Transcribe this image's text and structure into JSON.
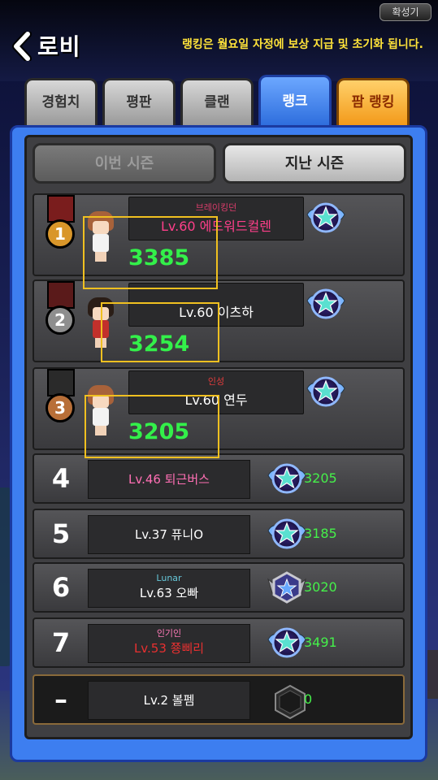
{
  "topbar": {
    "zoom_label": "확성기",
    "back_label": "로비",
    "notice": "랭킹은 월요일 자정에 보상 지급 및 초기화 됩니다."
  },
  "tabs": [
    {
      "label": "경험치"
    },
    {
      "label": "평판"
    },
    {
      "label": "클랜"
    },
    {
      "label": "랭크"
    },
    {
      "label": "팜 랭킹"
    }
  ],
  "active_tab": "랭크",
  "season": {
    "this_label": "이번 시즌",
    "last_label": "지난 시즌",
    "selected": "지난 시즌"
  },
  "top_ranks": [
    {
      "rank": "1",
      "medal_color": "#d9962a",
      "ribbon_color": "#7a1d1d",
      "guild": "브레이킹던",
      "guild_color": "#d73c6a",
      "name": "Lv.60 에드워드컬렌",
      "name_color": "#ff3f8a",
      "score": "3385",
      "hair": "#a8623a",
      "outfit": "#f3f3f3"
    },
    {
      "rank": "2",
      "medal_color": "#8e8e8e",
      "ribbon_color": "#5a1a1a",
      "guild": "",
      "guild_color": "#ffffff",
      "name": "Lv.60 이츠하",
      "name_color": "#ffffff",
      "score": "3254",
      "hair": "#2a1d16",
      "outfit": "#c2302b"
    },
    {
      "rank": "3",
      "medal_color": "#b86f38",
      "ribbon_color": "#2a2a2a",
      "guild": "인성",
      "guild_color": "#e03c3c",
      "name": "Lv.60 연두",
      "name_color": "#ffffff",
      "score": "3205",
      "hair": "#a8623a",
      "outfit": "#f3f3f3"
    }
  ],
  "list_ranks": [
    {
      "rank": "4",
      "guild": "",
      "guild_color": "#ffffff",
      "name": "Lv.46 퇴근버스",
      "name_color": "#ff6fb4",
      "score": "3205",
      "emblem": "star-wing-emblem-icon"
    },
    {
      "rank": "5",
      "guild": "",
      "guild_color": "#ffffff",
      "name": "Lv.37 퓨니O",
      "name_color": "#ffffff",
      "score": "3185",
      "emblem": "star-wing-emblem-icon"
    },
    {
      "rank": "6",
      "guild": "Lunar",
      "guild_color": "#66c7d9",
      "name": "Lv.63 오빠",
      "name_color": "#ffffff",
      "score": "3020",
      "emblem": "silver-wing-emblem-icon"
    },
    {
      "rank": "7",
      "guild": "인기인",
      "guild_color": "#ff7ab8",
      "name": "Lv.53 쭁삐리",
      "name_color": "#e83030",
      "score": "3491",
      "emblem": "star-wing-emblem-icon"
    }
  ],
  "my_rank": {
    "rank": "–",
    "name": "Lv.2 볼펨",
    "score": "0",
    "emblem": "empty-hexagon-icon"
  },
  "colors": {
    "frame_blue": "#3d7ef0",
    "score_green": "#33f04a",
    "highlight_yellow": "#f0c020",
    "notice_yellow": "#ffe33a"
  }
}
